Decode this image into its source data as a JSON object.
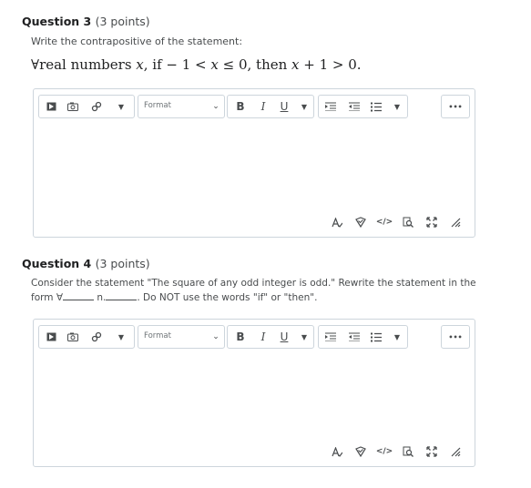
{
  "q3": {
    "title": "Question 3",
    "points": "(3 points)",
    "prompt": "Write the contrapositive of the statement:",
    "math": {
      "forall": "∀",
      "part1": "real numbers ",
      "var_x": "x",
      "part2": ", if ",
      "part3": " − 1 < ",
      "var_x2": "x",
      "part4": " ≤ 0, then ",
      "var_x3": "x",
      "part5": " + 1 > 0."
    }
  },
  "q4": {
    "title": "Question 4",
    "points": "(3 points)",
    "prompt_line1": "Consider the statement \"The square of any odd integer is odd.\" Rewrite the statement in the",
    "prompt_form": "form ∀",
    "prompt_n": "n.",
    "prompt_end": ". Do NOT use the words \"if\" or \"then\"."
  },
  "editor": {
    "format_label": "Format",
    "bold": "B",
    "italic": "I",
    "underline": "U",
    "more": "•••"
  }
}
